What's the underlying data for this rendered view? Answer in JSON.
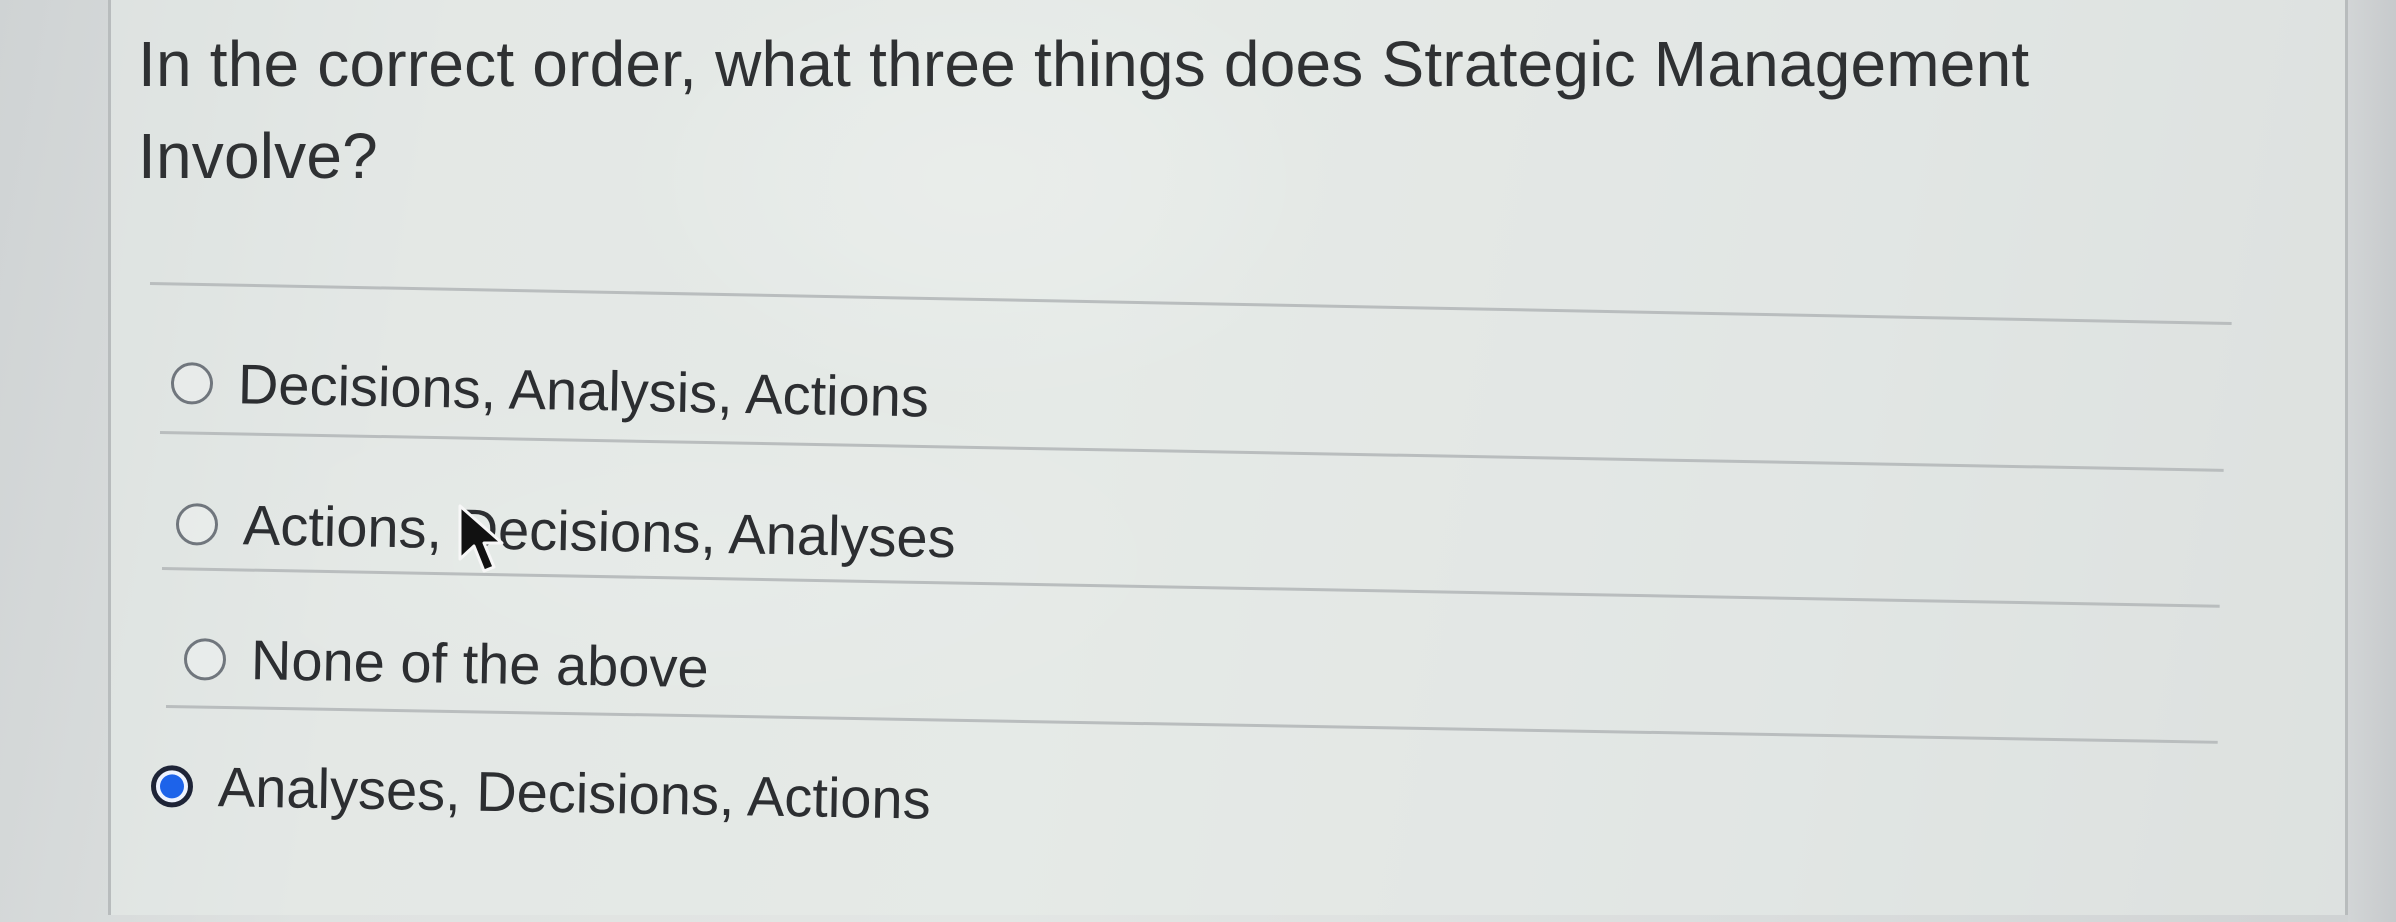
{
  "question": {
    "text": "In the correct order, what three things does Strategic Management Involve?"
  },
  "options": [
    {
      "label": "Decisions, Analysis, Actions",
      "selected": false
    },
    {
      "label": "Actions, Decisions, Analyses",
      "selected": false
    },
    {
      "label": "None of the above",
      "selected": false
    },
    {
      "label": "Analyses, Decisions, Actions",
      "selected": true
    }
  ],
  "icons": {
    "unselected_radio": "radio-unselected-icon",
    "selected_radio": "radio-selected-icon",
    "pointer": "mouse-pointer-icon"
  },
  "colors": {
    "text": "#2f3133",
    "divider": "#b9bdbe",
    "radio_selected": "#1d63ea"
  }
}
